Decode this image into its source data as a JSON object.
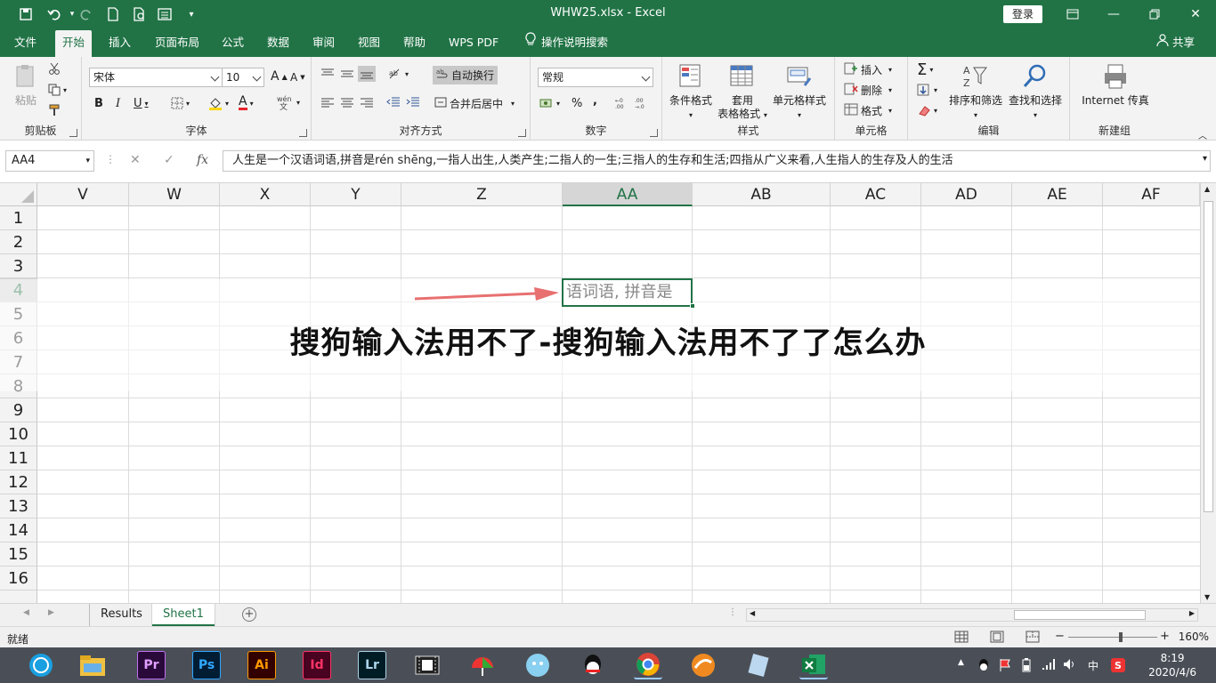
{
  "window": {
    "title": "WHW25.xlsx  -  Excel",
    "login": "登录"
  },
  "menu_tabs": [
    "文件",
    "开始",
    "插入",
    "页面布局",
    "公式",
    "数据",
    "审阅",
    "视图",
    "帮助",
    "WPS PDF",
    "操作说明搜索"
  ],
  "share": "共享",
  "ribbon": {
    "clipboard": {
      "paste": "粘贴",
      "label": "剪贴板"
    },
    "font": {
      "name": "宋体",
      "size": "10",
      "label": "字体",
      "bold": "B",
      "italic": "I",
      "underline": "U",
      "grow": "A",
      "shrink": "A",
      "color_a": "A"
    },
    "align": {
      "wrap": "自动换行",
      "merge": "合并后居中",
      "label": "对齐方式"
    },
    "number": {
      "format": "常规",
      "percent": "%",
      "comma": ",",
      "label": "数字"
    },
    "styles": {
      "cond": "条件格式",
      "table_a": "套用",
      "table_b": "表格格式",
      "cell": "单元格样式",
      "label": "样式"
    },
    "cells": {
      "insert": "插入",
      "delete": "删除",
      "format": "格式",
      "label": "单元格"
    },
    "editing": {
      "sort": "排序和筛选",
      "find": "查找和选择",
      "label": "编辑"
    },
    "newgroup": {
      "fax": "Internet 传真",
      "label": "新建组"
    }
  },
  "formula_bar": {
    "name_box": "AA4",
    "fx": "fx",
    "formula": "人生是一个汉语词语,拼音是rén shēng,一指人出生,人类产生;二指人的一生;三指人的生存和生活;四指从广义来看,人生指人的生存及人的生活"
  },
  "columns": [
    "V",
    "W",
    "X",
    "Y",
    "Z",
    "AA",
    "AB",
    "AC",
    "AD",
    "AE",
    "AF"
  ],
  "rows": [
    "1",
    "2",
    "3",
    "4",
    "5",
    "6",
    "7",
    "8",
    "9",
    "10",
    "11",
    "12",
    "13",
    "14",
    "15",
    "16"
  ],
  "active_cell_text": "语词语, 拼音是",
  "overlay_title": "搜狗输入法用不了-搜狗输入法用不了了怎么办",
  "sheets": [
    "Results",
    "Sheet1"
  ],
  "status": {
    "ready": "就绪",
    "zoom": "160%",
    "minus": "−",
    "plus": "+"
  },
  "taskbar": {
    "apps": [
      "Pr",
      "Ps",
      "Ai",
      "Id",
      "Lr"
    ],
    "tray": [
      "中"
    ],
    "time": "8:19",
    "date": "2020/4/6"
  }
}
